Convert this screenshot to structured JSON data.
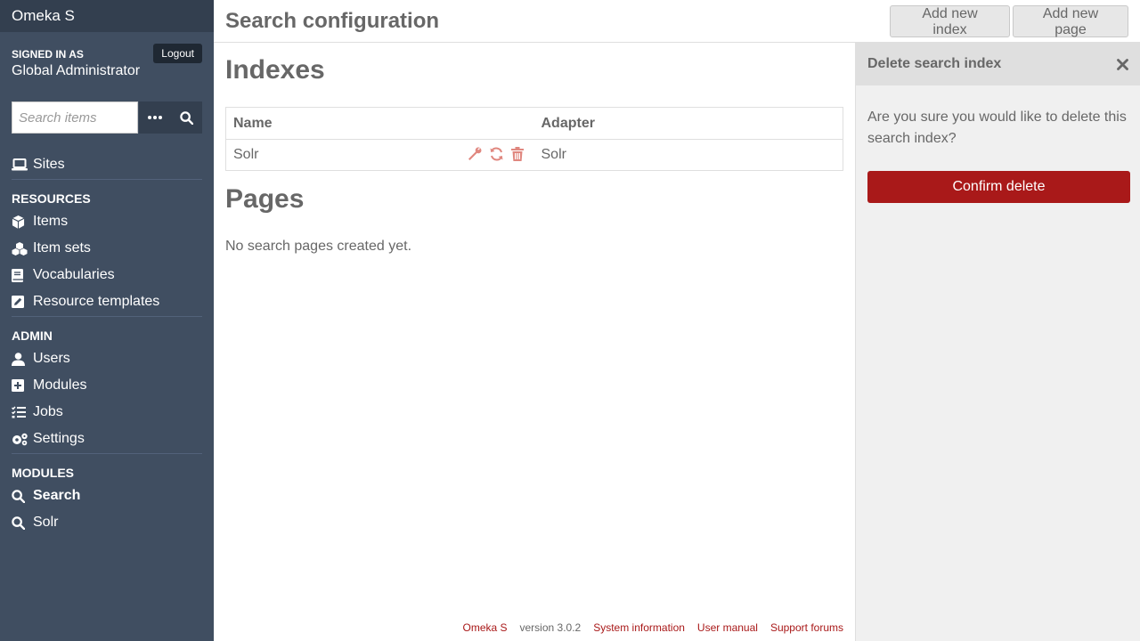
{
  "sidebar": {
    "brand": "Omeka S",
    "signed_in_label": "Signed in as",
    "user_role": "Global Administrator",
    "logout_label": "Logout",
    "search_placeholder": "Search items",
    "nav_top": [
      {
        "label": "Sites",
        "icon": "laptop-icon"
      }
    ],
    "sections": [
      {
        "label": "Resources",
        "items": [
          {
            "label": "Items",
            "icon": "cube-icon"
          },
          {
            "label": "Item sets",
            "icon": "cubes-icon"
          },
          {
            "label": "Vocabularies",
            "icon": "book-icon"
          },
          {
            "label": "Resource templates",
            "icon": "edit-icon"
          }
        ]
      },
      {
        "label": "Admin",
        "items": [
          {
            "label": "Users",
            "icon": "user-icon"
          },
          {
            "label": "Modules",
            "icon": "plus-square-icon"
          },
          {
            "label": "Jobs",
            "icon": "tasks-icon"
          },
          {
            "label": "Settings",
            "icon": "cogs-icon"
          }
        ]
      },
      {
        "label": "Modules",
        "items": [
          {
            "label": "Search",
            "icon": "search-icon",
            "active": true
          },
          {
            "label": "Solr",
            "icon": "search-icon"
          }
        ]
      }
    ]
  },
  "header": {
    "title": "Search configuration",
    "add_index_label": "Add new index",
    "add_page_label": "Add new page"
  },
  "main": {
    "indexes_heading": "Indexes",
    "table": {
      "headers": [
        "Name",
        "Adapter"
      ],
      "rows": [
        {
          "name": "Solr",
          "adapter": "Solr"
        }
      ]
    },
    "pages_heading": "Pages",
    "no_pages_text": "No search pages created yet."
  },
  "panel": {
    "title": "Delete search index",
    "message": "Are you sure you would like to delete this search index?",
    "confirm_label": "Confirm delete"
  },
  "footer": {
    "brand_link": "Omeka S",
    "version": "version 3.0.2",
    "links": [
      "System information",
      "User manual",
      "Support forums"
    ]
  },
  "colors": {
    "sidebar_bg": "#404e61",
    "sidebar_header_bg": "#333f4f",
    "accent_red": "#a91919",
    "action_icon": "#e0877f"
  }
}
